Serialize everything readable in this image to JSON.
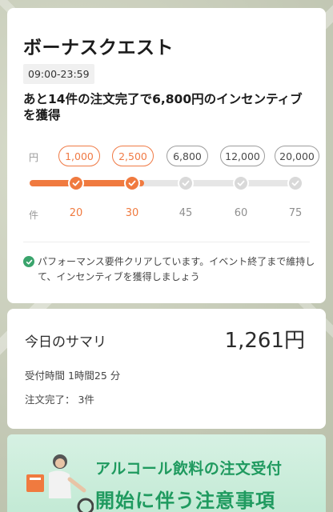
{
  "quest": {
    "title": "ボーナスクエスト",
    "time_range": "09:00-23:59",
    "description": "あと14件の注文完了で6,800円のインセンティブを獲得",
    "yen_label": "円",
    "count_label": "件",
    "tiers": [
      {
        "amount": "1,000",
        "count": "20",
        "done": true
      },
      {
        "amount": "2,500",
        "count": "30",
        "done": true
      },
      {
        "amount": "6,800",
        "count": "45",
        "done": false
      },
      {
        "amount": "12,000",
        "count": "60",
        "done": false
      },
      {
        "amount": "20,000",
        "count": "75",
        "done": false
      }
    ],
    "progress_fraction": 0.42,
    "notice": "パフォーマンス要件クリアしています。イベント終了まで維持して、インセンティブを獲得しましょう"
  },
  "summary": {
    "title": "今日のサマリ",
    "amount": "1,261円",
    "online_time": "受付時間 1時間25 分",
    "completed": "注文完了： 3件"
  },
  "banner": {
    "line1": "アルコール飲料の注文受付",
    "line2": "開始に伴う注意事項"
  },
  "colors": {
    "accent": "#f07a3f",
    "success": "#3aa46c",
    "banner_text": "#1f9a5f"
  }
}
